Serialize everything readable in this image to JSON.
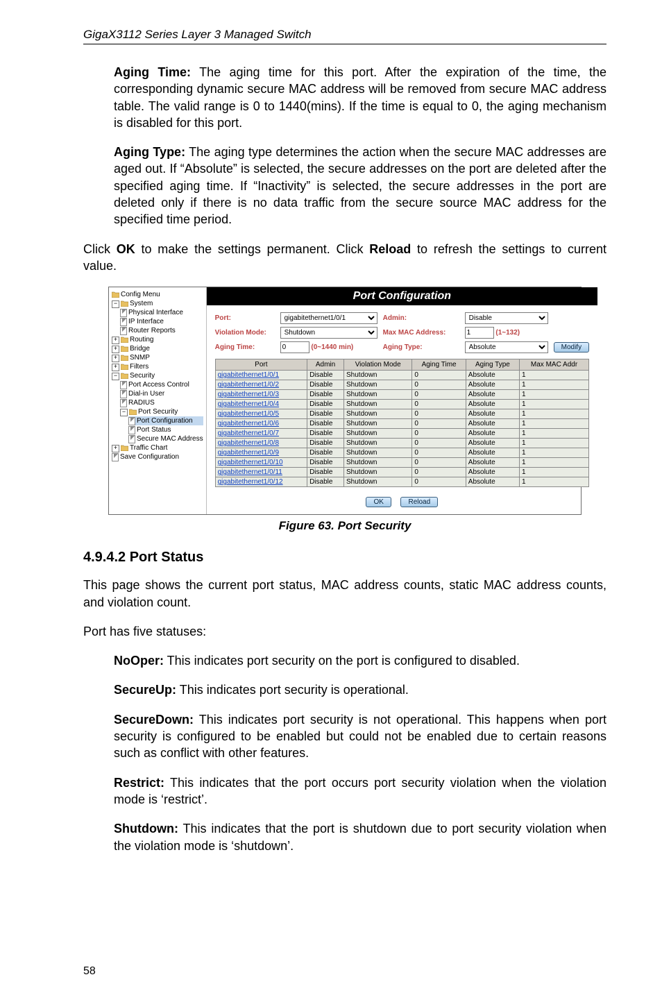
{
  "running_head": "GigaX3112 Series Layer 3 Managed Switch",
  "p1": {
    "label": "Aging Time:",
    "text": " The aging time for this port. After the expiration of the time, the corresponding dynamic secure MAC address will be removed from secure MAC address table. The valid range is 0 to 1440(mins). If the time is equal to 0, the aging mechanism is disabled for this port."
  },
  "p2": {
    "label": "Aging Type:",
    "text": " The aging type determines the action when the secure MAC addresses are aged out. If “Absolute” is selected, the secure addresses on the port are deleted after the specified aging time. If “Inactivity” is selected, the secure addresses in the port are deleted only if there is no data traffic from the secure source MAC address for the specified time period."
  },
  "p3": {
    "pre": "Click ",
    "b1": "OK",
    "mid": " to make the settings permanent. Click ",
    "b2": "Reload",
    "post": " to refresh the settings to current value."
  },
  "tree": [
    {
      "lvl": 0,
      "kind": "folder",
      "label": "Config Menu"
    },
    {
      "lvl": 0,
      "kind": "folder",
      "pm": "-",
      "label": "System"
    },
    {
      "lvl": 1,
      "kind": "doc",
      "label": "Physical Interface"
    },
    {
      "lvl": 1,
      "kind": "doc",
      "label": "IP Interface"
    },
    {
      "lvl": 1,
      "kind": "doc",
      "label": "Router Reports"
    },
    {
      "lvl": 0,
      "kind": "folder",
      "pm": "+",
      "label": "Routing"
    },
    {
      "lvl": 0,
      "kind": "folder",
      "pm": "+",
      "label": "Bridge"
    },
    {
      "lvl": 0,
      "kind": "folder",
      "pm": "+",
      "label": "SNMP"
    },
    {
      "lvl": 0,
      "kind": "folder",
      "pm": "+",
      "label": "Filters"
    },
    {
      "lvl": 0,
      "kind": "folder",
      "pm": "-",
      "label": "Security"
    },
    {
      "lvl": 1,
      "kind": "doc",
      "label": "Port Access Control"
    },
    {
      "lvl": 1,
      "kind": "doc",
      "label": "Dial-in User"
    },
    {
      "lvl": 1,
      "kind": "doc",
      "label": "RADIUS"
    },
    {
      "lvl": 1,
      "kind": "folder",
      "pm": "-",
      "label": "Port Security"
    },
    {
      "lvl": 2,
      "kind": "doc",
      "label": "Port Configuration",
      "selected": true
    },
    {
      "lvl": 2,
      "kind": "doc",
      "label": "Port Status"
    },
    {
      "lvl": 2,
      "kind": "doc",
      "label": "Secure MAC Address"
    },
    {
      "lvl": 0,
      "kind": "folder",
      "pm": "+",
      "label": "Traffic Chart"
    },
    {
      "lvl": 0,
      "kind": "doc",
      "label": "Save Configuration"
    }
  ],
  "panel_title": "Port Configuration",
  "ctrl": {
    "port_label": "Port:",
    "port_value": "gigabitethernet1/0/1",
    "admin_label": "Admin:",
    "admin_value": "Disable",
    "viol_label": "Violation Mode:",
    "viol_value": "Shutdown",
    "maxmac_label": "Max MAC Address:",
    "maxmac_value": "1",
    "maxmac_hint": "(1~132)",
    "aging_label": "Aging Time:",
    "aging_value": "0",
    "aging_hint": "(0~1440 min)",
    "atype_label": "Aging Type:",
    "atype_value": "Absolute",
    "modify": "Modify"
  },
  "grid": {
    "head": [
      "Port",
      "Admin",
      "Violation Mode",
      "Aging Time",
      "Aging Type",
      "Max MAC Addr"
    ],
    "rows": [
      [
        "gigabitethernet1/0/1",
        "Disable",
        "Shutdown",
        "0",
        "Absolute",
        "1"
      ],
      [
        "gigabitethernet1/0/2",
        "Disable",
        "Shutdown",
        "0",
        "Absolute",
        "1"
      ],
      [
        "gigabitethernet1/0/3",
        "Disable",
        "Shutdown",
        "0",
        "Absolute",
        "1"
      ],
      [
        "gigabitethernet1/0/4",
        "Disable",
        "Shutdown",
        "0",
        "Absolute",
        "1"
      ],
      [
        "gigabitethernet1/0/5",
        "Disable",
        "Shutdown",
        "0",
        "Absolute",
        "1"
      ],
      [
        "gigabitethernet1/0/6",
        "Disable",
        "Shutdown",
        "0",
        "Absolute",
        "1"
      ],
      [
        "gigabitethernet1/0/7",
        "Disable",
        "Shutdown",
        "0",
        "Absolute",
        "1"
      ],
      [
        "gigabitethernet1/0/8",
        "Disable",
        "Shutdown",
        "0",
        "Absolute",
        "1"
      ],
      [
        "gigabitethernet1/0/9",
        "Disable",
        "Shutdown",
        "0",
        "Absolute",
        "1"
      ],
      [
        "gigabitethernet1/0/10",
        "Disable",
        "Shutdown",
        "0",
        "Absolute",
        "1"
      ],
      [
        "gigabitethernet1/0/11",
        "Disable",
        "Shutdown",
        "0",
        "Absolute",
        "1"
      ],
      [
        "gigabitethernet1/0/12",
        "Disable",
        "Shutdown",
        "0",
        "Absolute",
        "1"
      ]
    ]
  },
  "ok": "OK",
  "reload": "Reload",
  "fig_caption": "Figure 63. Port Security",
  "h3": "4.9.4.2    Port Status",
  "q1": "This page shows the current port status, MAC address counts, static MAC address counts, and violation count.",
  "q2": "Port has five statuses:",
  "q3": {
    "label": "NoOper:",
    "text": " This indicates port security on the port is configured to disabled."
  },
  "q4": {
    "label": "SecureUp:",
    "text": " This indicates port security is operational."
  },
  "q5": {
    "label": "SecureDown:",
    "text": " This indicates port security is not operational. This happens when port security is configured to be enabled but could not be enabled due to certain reasons such as conflict with other features."
  },
  "q6": {
    "label": "Restrict:",
    "text": " This indicates that the port occurs port security violation when the violation mode is ‘restrict’."
  },
  "q7": {
    "label": "Shutdown:",
    "text": " This indicates that the port is shutdown due to port security violation when the violation mode is ‘shutdown’."
  },
  "page_number": "58"
}
